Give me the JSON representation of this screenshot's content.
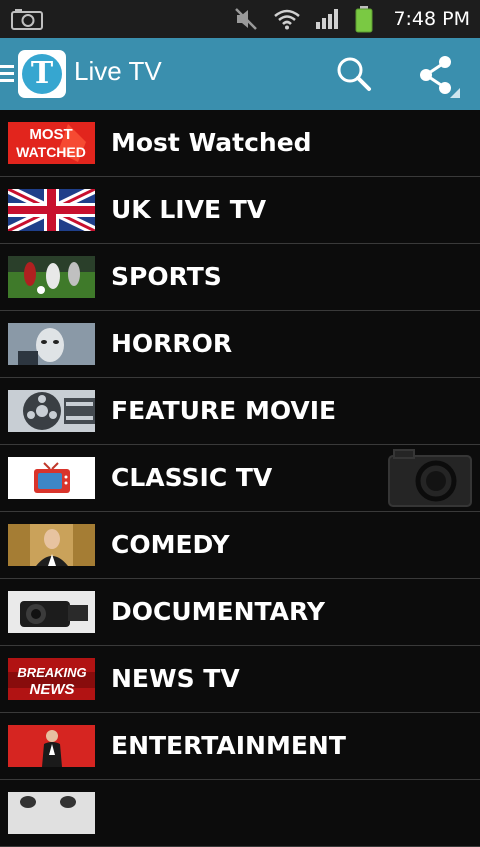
{
  "status_bar": {
    "time": "7:48 PM",
    "icons": [
      "camera-icon",
      "mute-icon",
      "wifi-icon",
      "signal-icon",
      "battery-icon"
    ],
    "battery_color": "#7ac943"
  },
  "action_bar": {
    "title": "Live TV",
    "logo_letter": "T",
    "background": "#3a8fae",
    "icons": [
      "menu-icon",
      "search-icon",
      "share-icon"
    ]
  },
  "categories": [
    {
      "label": "Most Watched",
      "thumb_text_1": "MOST",
      "thumb_text_2": "WATCHED"
    },
    {
      "label": "UK LIVE TV"
    },
    {
      "label": "SPORTS"
    },
    {
      "label": "HORROR"
    },
    {
      "label": "FEATURE MOVIE"
    },
    {
      "label": "CLASSIC TV"
    },
    {
      "label": "COMEDY"
    },
    {
      "label": "DOCUMENTARY"
    },
    {
      "label": "NEWS TV",
      "thumb_text_1": "BREAKING",
      "thumb_text_2": "NEWS"
    },
    {
      "label": "ENTERTAINMENT"
    }
  ],
  "overlay": {
    "icon": "camera-icon"
  }
}
